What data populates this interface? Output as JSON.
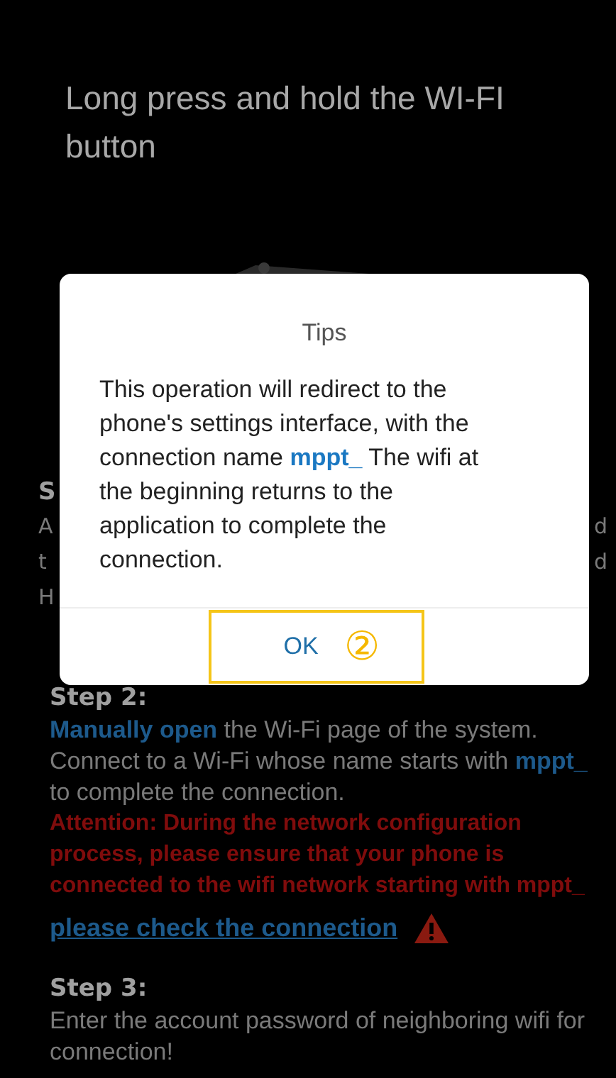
{
  "page": {
    "title": "Long press and hold the WI-FI button",
    "steps": [
      {
        "heading": "S",
        "fragments": [
          {
            "left": "A",
            "right": "d"
          },
          {
            "left": "t",
            "right": "d"
          },
          {
            "left": "H"
          }
        ]
      },
      {
        "heading": "Step 2:",
        "text": "**Manually open** the Wi-Fi page of the system. Connect to a Wi-Fi whose name starts with **mppt_** to complete the connection.",
        "attention": "Attention: During the network configuration process, please ensure that your phone is connected to the wifi network starting with mppt_",
        "link": "please check the connection"
      },
      {
        "heading": "Step 3:",
        "text": "Enter the account password of neighboring wifi for connection!"
      }
    ]
  },
  "dialog": {
    "title": "Tips",
    "message": "This operation will redirect to the phone's settings interface, with the connection name **mppt_** The wifi at the beginning returns to the application to complete the connection.",
    "button": "OK",
    "annotation": "②"
  }
}
